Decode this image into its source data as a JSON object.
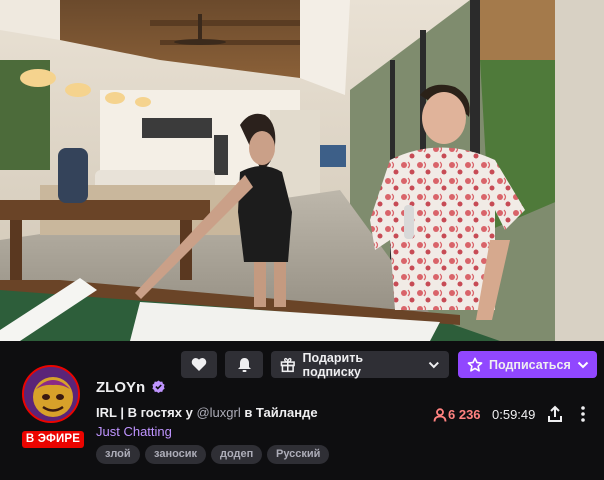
{
  "actions": {
    "gift_label": "Подарить подписку",
    "subscribe_label": "Подписаться"
  },
  "channel": {
    "name": "ZLOYn",
    "live_badge": "В ЭФИРЕ",
    "title_prefix": "IRL | В гостях у ",
    "title_mention": "@luxgrl",
    "title_suffix": " в Тайланде",
    "category": "Just Chatting",
    "tags": [
      "злой",
      "заносик",
      "додеп",
      "Русский"
    ]
  },
  "stats": {
    "viewers": "6 236",
    "uptime": "0:59:49"
  },
  "colors": {
    "accent": "#9147ff",
    "live": "#eb0400",
    "viewers": "#ff8280",
    "category": "#bf94ff",
    "button_bg": "#2f2f35",
    "background": "#0e0e10"
  },
  "icons": [
    "heart-icon",
    "bell-icon",
    "gift-icon",
    "chevron-down-icon",
    "star-icon",
    "verified-icon",
    "person-icon",
    "share-icon",
    "more-vertical-icon"
  ]
}
